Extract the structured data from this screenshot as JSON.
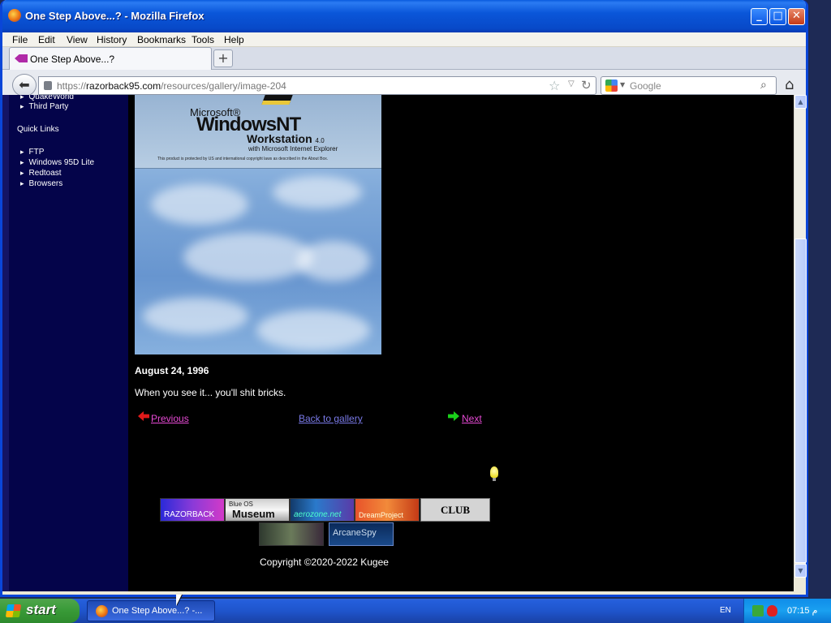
{
  "window": {
    "title": "One Step Above...? - Mozilla Firefox",
    "min": "_",
    "max": "□",
    "close": "✕"
  },
  "menu": {
    "file": "File",
    "edit": "Edit",
    "view": "View",
    "history": "History",
    "bookmarks": "Bookmarks",
    "tools": "Tools",
    "help": "Help"
  },
  "tab": {
    "label": "One Step Above...?",
    "new_tab": "+"
  },
  "navbar": {
    "url_prefix": "https://",
    "url_host": "razorback95.com",
    "url_path": "/resources/gallery/image-204",
    "search_placeholder": "Google"
  },
  "sidebar": {
    "top_items": [
      "QuakeWorld",
      "Third Party"
    ],
    "quick_links_heading": "Quick Links",
    "quick_links": [
      "FTP",
      "Windows 95D Lite",
      "Redtoast",
      "Browsers"
    ]
  },
  "image": {
    "ms": "Microsoft®",
    "product": "WindowsNT",
    "edition": "Workstation",
    "version": "4.0",
    "tagline": "with Microsoft Internet Explorer",
    "fine_print": "This product is protected by US and international copyright laws as described in the About Box."
  },
  "post": {
    "date": "August 24, 1996",
    "caption": "When you see it... you'll shit bricks.",
    "previous": "Previous",
    "back": "Back to gallery",
    "next": "Next"
  },
  "banners": {
    "razorback": "RAZORBACK",
    "blueos_small": "Blue OS",
    "museum": "Museum",
    "aerozone": "aerozone.net",
    "dreamproject": "DreamProject",
    "club": "CLUB",
    "arcanespy": "ArcaneSpy"
  },
  "footer": {
    "copyright": "Copyright ©2020-2022 Kugee"
  },
  "taskbar": {
    "start": "start",
    "task_label": "One Step Above...? -...",
    "lang": "EN",
    "time": "07:15 م"
  }
}
